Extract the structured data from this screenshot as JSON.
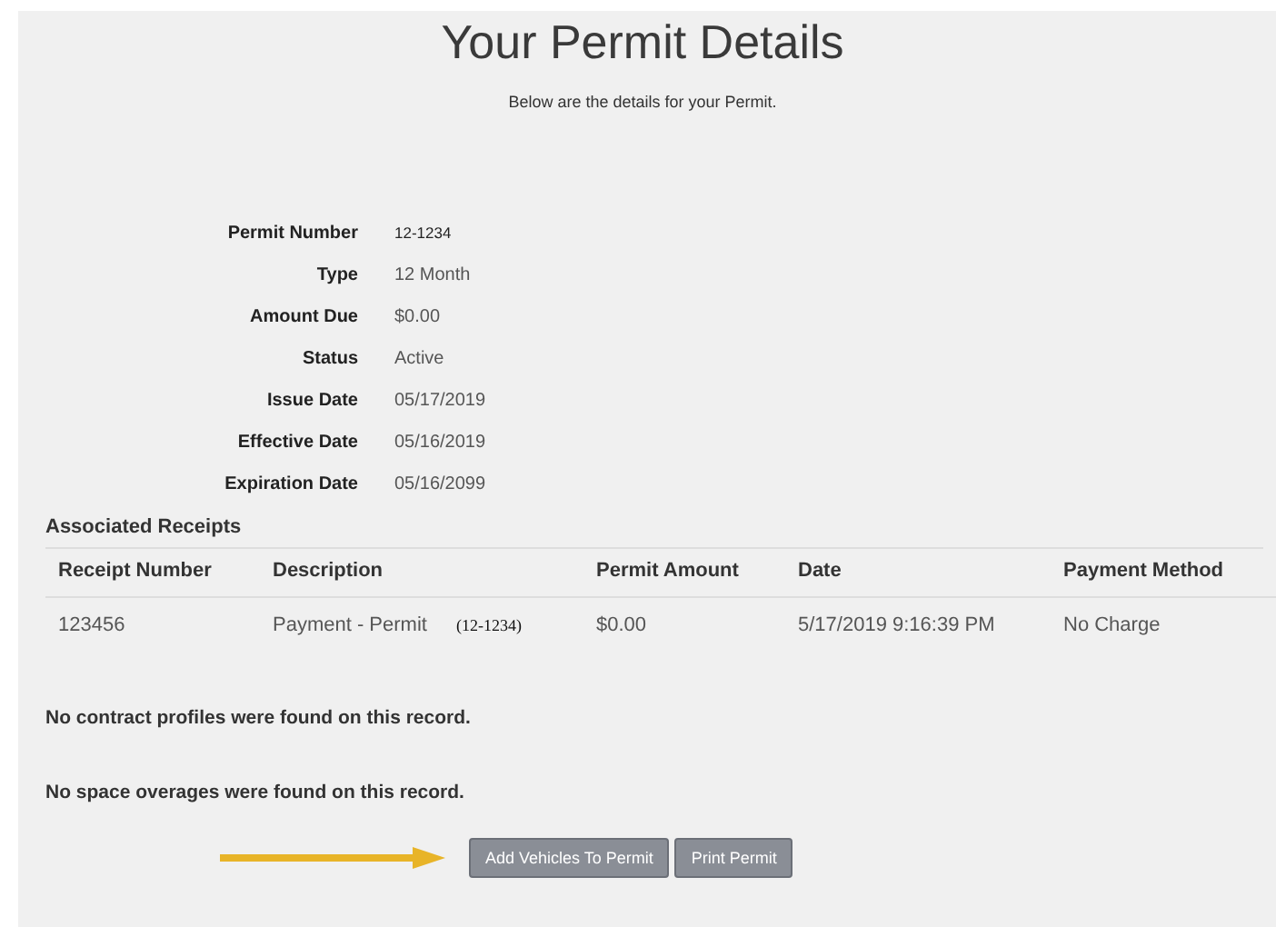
{
  "title": "Your Permit Details",
  "subtitle": "Below are the details for your Permit.",
  "details": [
    {
      "label": "Permit Number",
      "value": "12-1234",
      "kind": "small"
    },
    {
      "label": "Type",
      "value": "12 Month",
      "kind": "plain"
    },
    {
      "label": "Amount Due",
      "value": "$0.00",
      "kind": "plain"
    },
    {
      "label": "Status",
      "value": "Active",
      "kind": "plain"
    },
    {
      "label": "Issue Date",
      "value": "05/17/2019",
      "kind": "plain"
    },
    {
      "label": "Effective Date",
      "value": "05/16/2019",
      "kind": "plain"
    },
    {
      "label": "Expiration Date",
      "value": "05/16/2099",
      "kind": "plain"
    }
  ],
  "receipts": {
    "heading": "Associated Receipts",
    "columns": [
      "Receipt Number",
      "Description",
      "Permit Amount",
      "Date",
      "Payment Method"
    ],
    "rows": [
      {
        "receipt_number": "123456",
        "description": "Payment - Permit",
        "reference": "(12-1234)",
        "permit_amount": "$0.00",
        "date": "5/17/2019 9:16:39 PM",
        "payment_method": "No Charge"
      }
    ]
  },
  "messages": [
    "No contract profiles were found on this record.",
    "No space overages were found on this record."
  ],
  "buttons": [
    "Add Vehicles To Permit",
    "Print Permit"
  ]
}
